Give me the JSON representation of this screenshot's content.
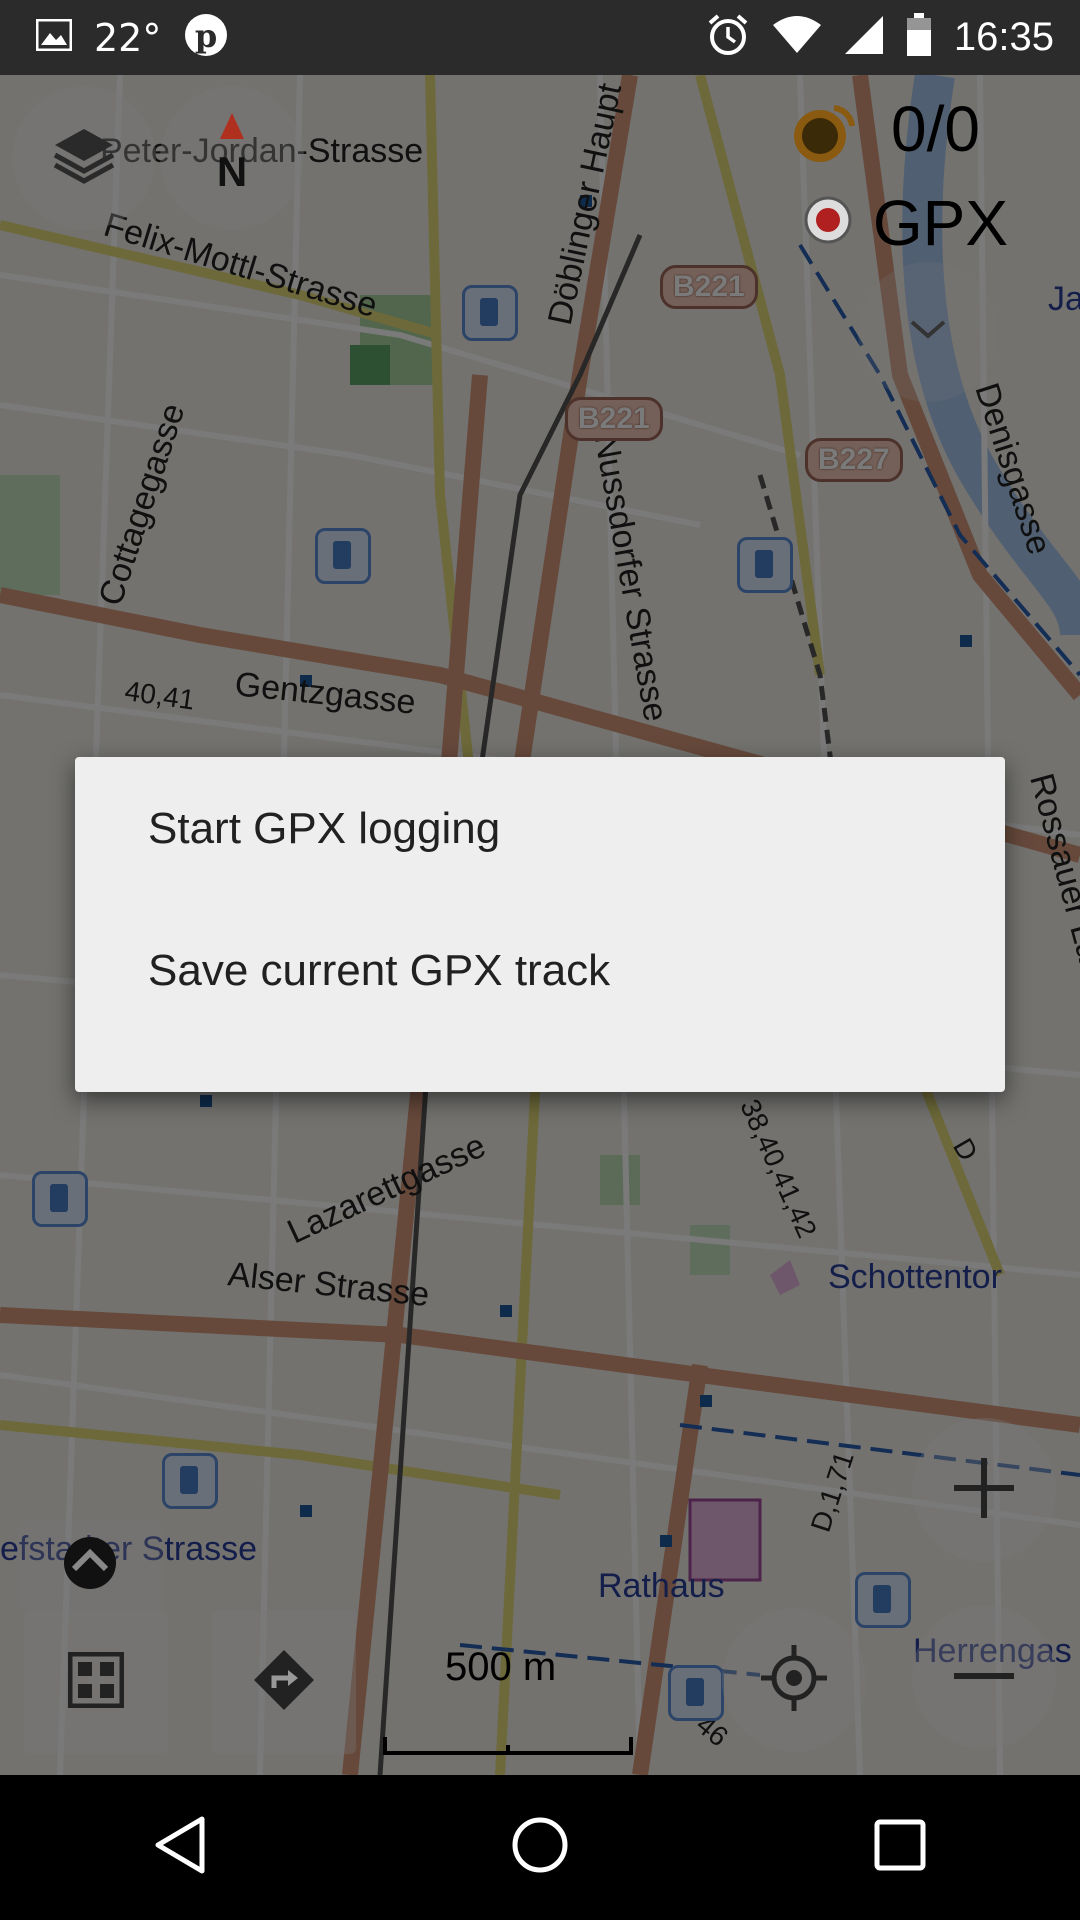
{
  "status_bar": {
    "temperature": "22°",
    "time": "16:35",
    "icons": [
      "image-icon",
      "pinterest-icon",
      "alarm-icon",
      "wifi-icon",
      "signal-icon",
      "battery-icon"
    ]
  },
  "map": {
    "streets": [
      {
        "text": "Peter-Jordan-Strasse"
      },
      {
        "text": "Felix-Mottl-Strasse"
      },
      {
        "text": "Döblinger Haupt"
      },
      {
        "text": "Cottagegasse"
      },
      {
        "text": "Nussdorfer Strasse"
      },
      {
        "text": "Gentzgasse"
      },
      {
        "text": "Denisgasse"
      },
      {
        "text": "Lazarettgasse"
      },
      {
        "text": "Alser Strasse"
      },
      {
        "text": "Schottentor"
      },
      {
        "text": "Rathaus"
      },
      {
        "text": "Herrengas"
      },
      {
        "text": "efstadter Strasse"
      },
      {
        "text": "Rossauer Lände"
      },
      {
        "text": "Jage"
      },
      {
        "text": "40,41"
      },
      {
        "text": "38,40,41,42"
      },
      {
        "text": "D,1,71"
      },
      {
        "text": "D"
      },
      {
        "text": "46"
      }
    ],
    "road_badges": [
      "B221",
      "B221",
      "B227"
    ],
    "satellite_counter": "0/0",
    "gpx_label": "GPX",
    "scale_label": "500 m",
    "compass_letter": "N"
  },
  "dialog": {
    "items": [
      "Start GPX logging",
      "Save current GPX track"
    ]
  },
  "colors": {
    "dialog_bg": "#eeeeee",
    "status_bar_bg": "#2b2b2b",
    "dim_overlay": "rgba(0,0,0,0.52)"
  }
}
